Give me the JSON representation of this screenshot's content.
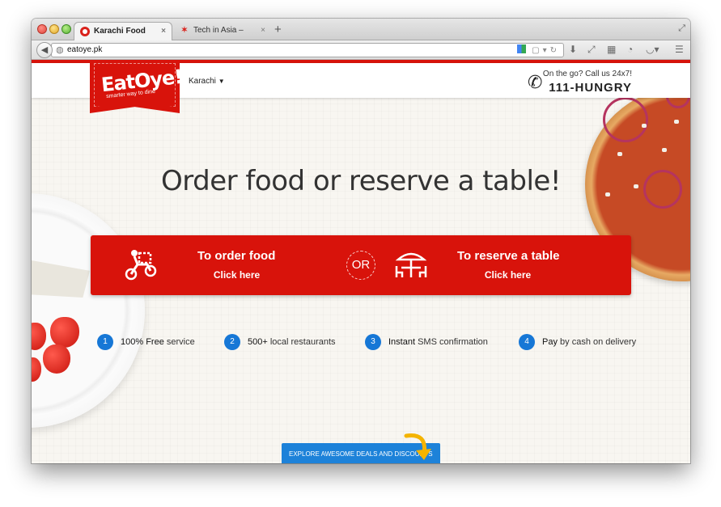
{
  "browser": {
    "tabs": [
      {
        "title": "Karachi Food Deliv...",
        "close": "×"
      },
      {
        "title": "Tech in Asia – Asia...",
        "close": "×"
      }
    ],
    "new_tab": "+",
    "url": "eatoye.pk"
  },
  "header": {
    "logo_text": "EatOye!",
    "logo_tagline": "smarter way to dine",
    "city": "Karachi",
    "call_prompt": "On the go? Call us 24x7!",
    "phone": "111-HUNGRY"
  },
  "hero": {
    "heading": "Order food or reserve a table!"
  },
  "cta": {
    "order_title": "To order food",
    "order_action": "Click here",
    "or_label": "OR",
    "reserve_title": "To reserve a table",
    "reserve_action": "Click here"
  },
  "features": [
    {
      "number": "1",
      "bold": "100% Free",
      "rest": " service"
    },
    {
      "number": "2",
      "bold": "500+",
      "rest": " local restaurants"
    },
    {
      "number": "3",
      "bold": "Instant",
      "rest": " SMS confirmation"
    },
    {
      "number": "4",
      "bold": "Pay",
      "rest": " by cash on delivery"
    }
  ],
  "deals": {
    "label": "EXPLORE AWESOME DEALS AND DISCOUNTS"
  },
  "colors": {
    "brand_red": "#d8130b",
    "feature_blue": "#1677d6",
    "deals_blue": "#1d82d9",
    "arrow_yellow": "#f4b400"
  }
}
